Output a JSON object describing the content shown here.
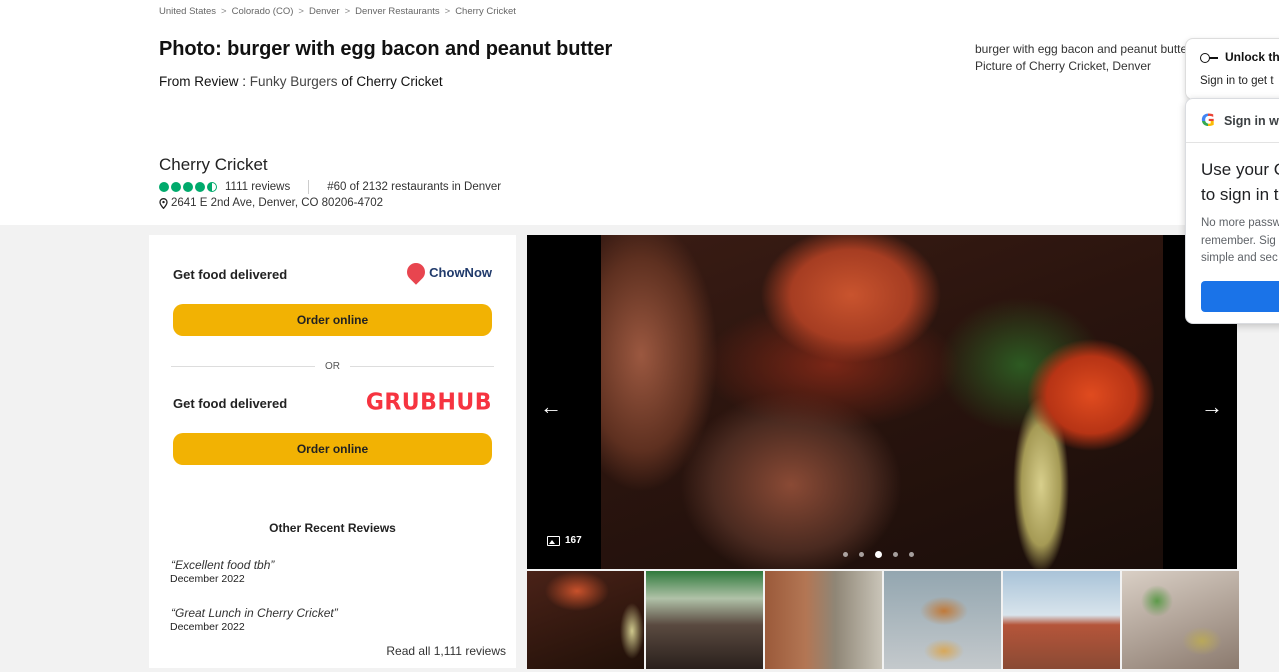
{
  "breadcrumb": [
    "United States",
    "Colorado (CO)",
    "Denver",
    "Denver Restaurants",
    "Cherry Cricket"
  ],
  "breadcrumb_separator": ">",
  "title": "Photo: burger with egg bacon and peanut butter",
  "from_review": {
    "prefix": "From Review : ",
    "review_title": "Funky Burgers",
    "suffix": " of Cherry Cricket"
  },
  "caption": {
    "line1": "burger with egg bacon and peanut butter",
    "line2": "Picture of Cherry Cricket, Denver"
  },
  "restaurant": {
    "name": "Cherry Cricket",
    "rating_bubbles": 4.5,
    "reviews_count": "1111 reviews",
    "rank": "#60 of 2132 restaurants in Denver",
    "address": "2641 E 2nd Ave, Denver, CO 80206-4702"
  },
  "delivery": {
    "chownow": {
      "label": "Get food delivered",
      "brand": "ChowNow",
      "button": "Order online",
      "brand_color": "#e8454f"
    },
    "or_text": "OR",
    "grubhub": {
      "label": "Get food delivered",
      "brand": "GRUBHUB",
      "button": "Order online",
      "brand_color": "#f63440"
    },
    "button_color": "#f2b203"
  },
  "other_reviews": {
    "title": "Other Recent Reviews",
    "items": [
      {
        "quote": "“Excellent food tbh”",
        "date": "December 2022"
      },
      {
        "quote": "“Great Lunch in Cherry Cricket”",
        "date": "December 2022"
      }
    ],
    "read_all": "Read all 1,111 reviews"
  },
  "gallery": {
    "photo_count": "167",
    "dots_total": 5,
    "dots_active_index": 2,
    "left_arrow": "←",
    "right_arrow": "→",
    "thumbnails": 6
  },
  "popup_unlock": {
    "title": "Unlock th",
    "subtitle": "Sign in to get t"
  },
  "popup_google": {
    "header": "Sign in w",
    "big_line1": "Use your G",
    "big_line2": "to sign in t",
    "small_line1": "No more passw",
    "small_line2": "remember. Sig",
    "small_line3": "simple and sec",
    "button_color": "#1a73e8"
  },
  "accent_green": "#00aa6c"
}
